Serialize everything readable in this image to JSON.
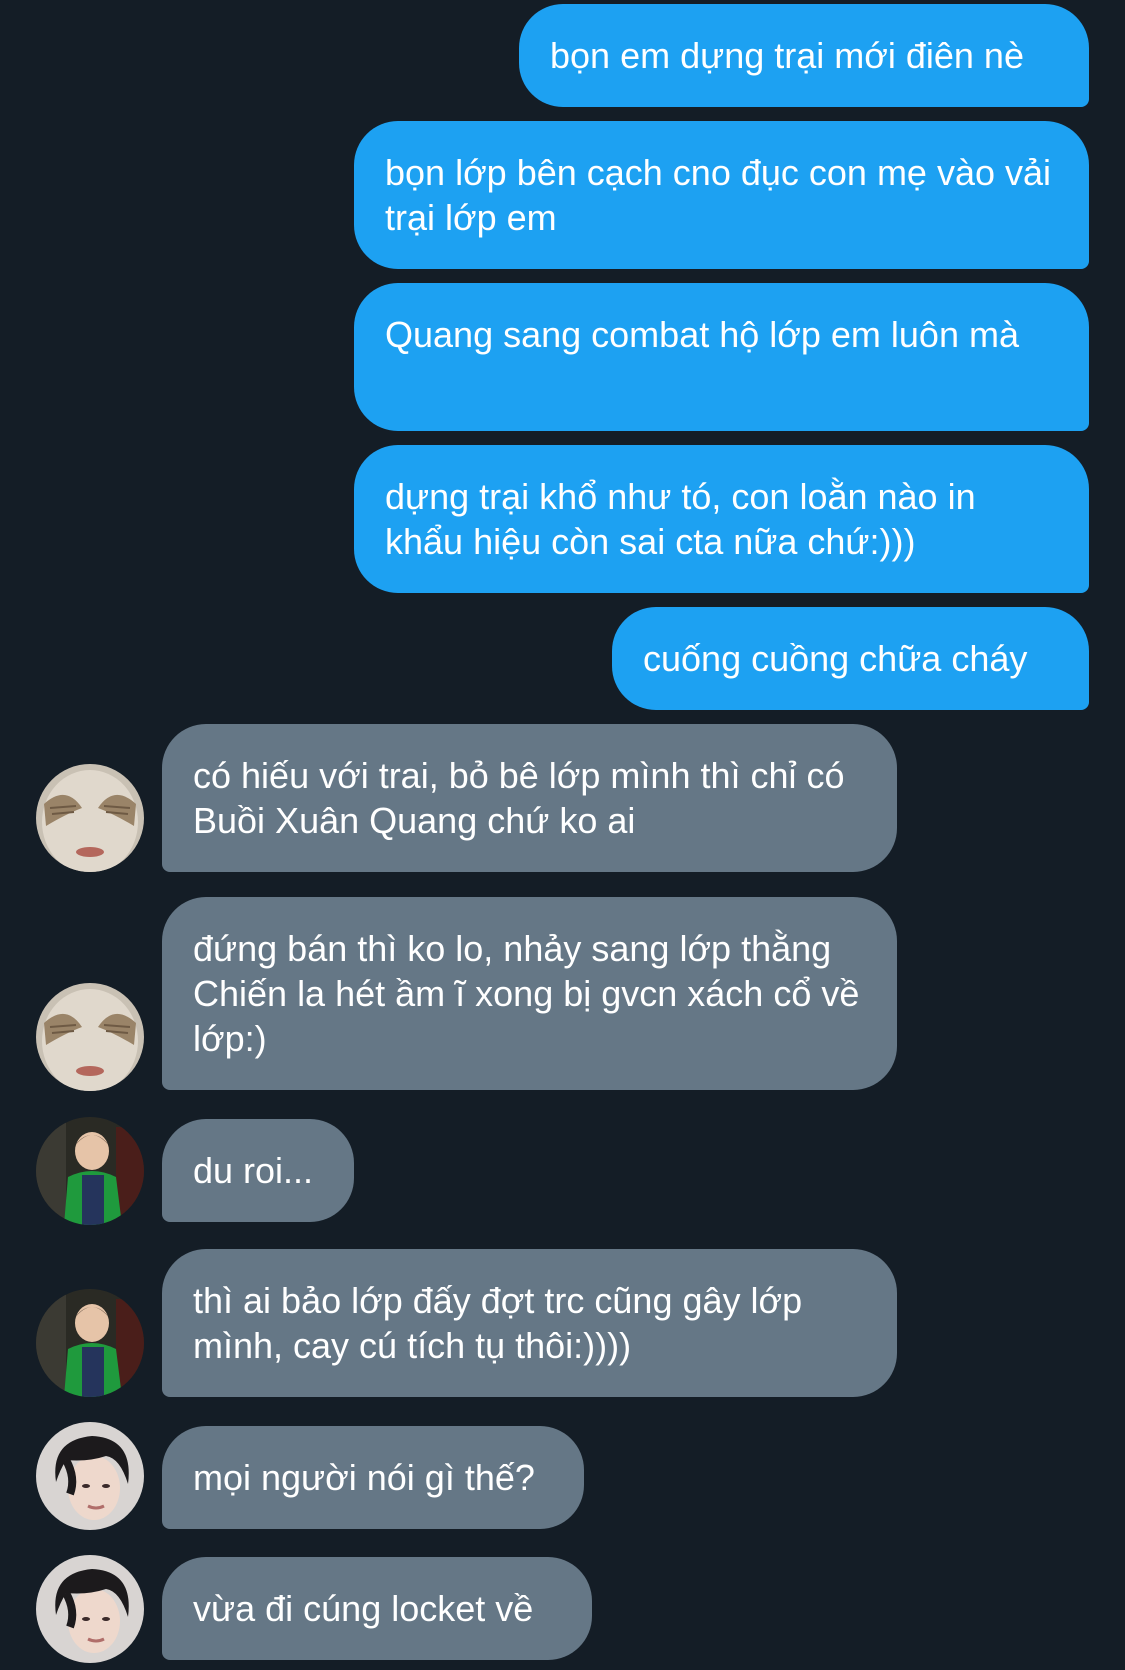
{
  "messages": [
    {
      "direction": "outgoing",
      "text": "bọn em dựng trại mới điên nè"
    },
    {
      "direction": "outgoing",
      "text": "bọn lớp bên cạch cno đục con mẹ vào vải trại lớp em"
    },
    {
      "direction": "outgoing",
      "text": "Quang sang combat hộ lớp em luôn mà"
    },
    {
      "direction": "outgoing",
      "text": "dựng trại khổ như tó, con loằn nào in khẩu hiệu còn sai cta nữa chứ:)))"
    },
    {
      "direction": "outgoing",
      "text": "cuống cuồng chữa cháy"
    },
    {
      "direction": "incoming",
      "avatar": "avatar-sculpture",
      "text": "có hiếu với trai, bỏ bê lớp mình thì chỉ có Buồi Xuân Quang chứ ko ai"
    },
    {
      "direction": "incoming",
      "avatar": "avatar-sculpture",
      "text": "đứng bán thì ko lo, nhảy sang lớp thằng Chiến la hét ầm ĩ xong bị gvcn xách cổ về lớp:)"
    },
    {
      "direction": "incoming",
      "avatar": "avatar-green-shirt",
      "text": "du roi..."
    },
    {
      "direction": "incoming",
      "avatar": "avatar-green-shirt",
      "text": "thì ai bảo lớp đấy đợt trc cũng gây lớp mình, cay cú tích tụ thôi:))))"
    },
    {
      "direction": "incoming",
      "avatar": "avatar-dark-hair",
      "text": "mọi người nói gì thế?"
    },
    {
      "direction": "incoming",
      "avatar": "avatar-dark-hair",
      "text": "vừa đi cúng locket về"
    }
  ],
  "colors": {
    "background": "#141d26",
    "outgoing_bubble": "#1da1f2",
    "incoming_bubble": "#657786",
    "text": "#ffffff"
  }
}
